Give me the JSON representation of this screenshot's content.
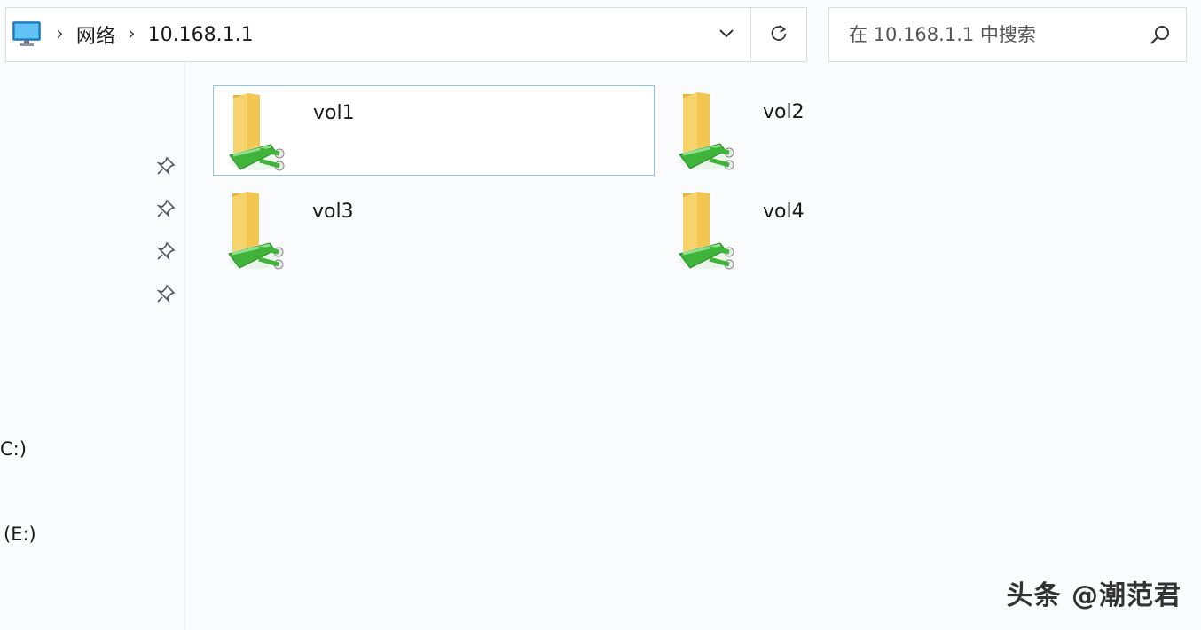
{
  "address_bar": {
    "crumbs": [
      "网络",
      "10.168.1.1"
    ]
  },
  "search": {
    "placeholder": "在 10.168.1.1 中搜索"
  },
  "nav": {
    "drives": [
      "C:)",
      "(E:)"
    ]
  },
  "folders": [
    {
      "name": "vol1",
      "selected": true
    },
    {
      "name": "vol2",
      "selected": false
    },
    {
      "name": "vol3",
      "selected": false
    },
    {
      "name": "vol4",
      "selected": false
    }
  ],
  "watermark": "头条 @潮范君",
  "icons": {
    "computer": "computer-icon",
    "chevron": "chevron-down-icon",
    "refresh": "refresh-icon",
    "search": "search-icon",
    "pin": "pin-icon",
    "share": "network-share-folder-icon"
  },
  "colors": {
    "selection_border": "#8fc3ea",
    "folder_yellow": "#f5c84c",
    "share_green": "#3fb33a"
  }
}
